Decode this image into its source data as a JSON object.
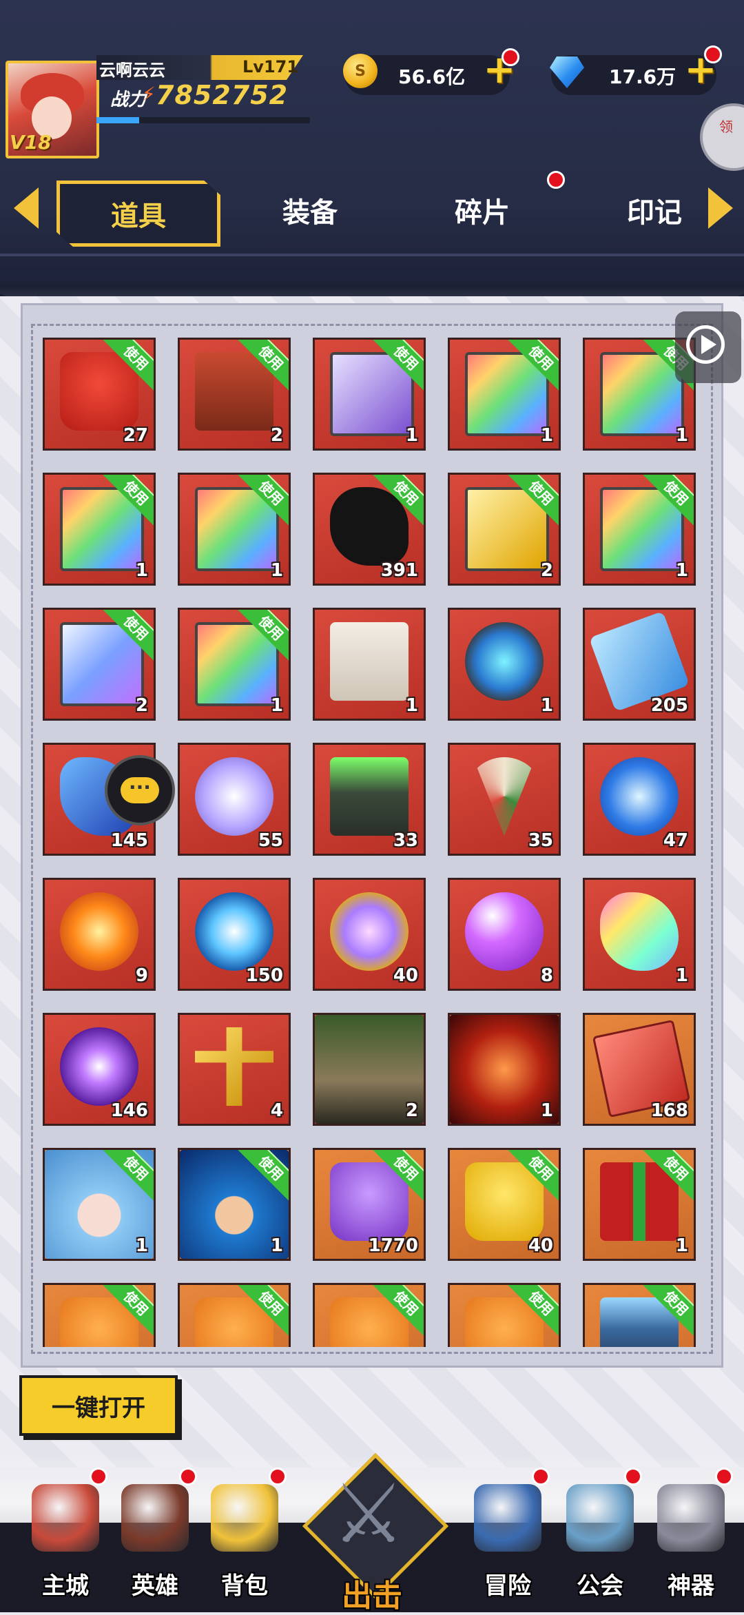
{
  "player": {
    "name": "云啊云云",
    "level": "Lv171",
    "vip": "V18",
    "power_label": "战力",
    "power": "7852752",
    "exp_fraction": 0.2
  },
  "currency": {
    "gold": "56.6亿",
    "gems": "17.6万"
  },
  "side_button_text": "领",
  "tabs": [
    {
      "label": "道具",
      "active": true
    },
    {
      "label": "装备",
      "active": false
    },
    {
      "label": "碎片",
      "active": false,
      "badge": true
    },
    {
      "label": "印记",
      "active": false
    }
  ],
  "use_tag": "使用",
  "items": [
    {
      "icon": "red-bag-icon",
      "count": "27",
      "use": true,
      "bg": "red"
    },
    {
      "icon": "treasure-chest-icon",
      "count": "2",
      "use": true,
      "bg": "red"
    },
    {
      "icon": "purple-card-pack-icon",
      "count": "1",
      "use": true,
      "bg": "red"
    },
    {
      "icon": "rainbow-card-pack-icon",
      "count": "1",
      "use": true,
      "bg": "red"
    },
    {
      "icon": "rainbow-card-pack-icon",
      "count": "1",
      "use": true,
      "bg": "red"
    },
    {
      "icon": "rainbow-card-pack-icon",
      "count": "1",
      "use": true,
      "bg": "red"
    },
    {
      "icon": "rainbow-card-pack-icon",
      "count": "1",
      "use": true,
      "bg": "red"
    },
    {
      "icon": "mystery-hero-icon",
      "count": "391",
      "use": true,
      "bg": "red"
    },
    {
      "icon": "gold-card-pack-icon",
      "count": "2",
      "use": true,
      "bg": "red"
    },
    {
      "icon": "rainbow-card-pack-icon",
      "count": "1",
      "use": true,
      "bg": "red"
    },
    {
      "icon": "glowing-card-pack-icon",
      "count": "2",
      "use": true,
      "bg": "red"
    },
    {
      "icon": "rainbow-card-pack-icon",
      "count": "1",
      "use": true,
      "bg": "red"
    },
    {
      "icon": "scroll-icon",
      "count": "1",
      "use": false,
      "bg": "red"
    },
    {
      "icon": "blue-rune-icon",
      "count": "1",
      "use": false,
      "bg": "red"
    },
    {
      "icon": "blue-ticket-icon",
      "count": "205",
      "use": false,
      "bg": "red"
    },
    {
      "icon": "blue-crystal-icon",
      "count": "145",
      "use": false,
      "bg": "red"
    },
    {
      "icon": "silver-coin-icon",
      "count": "55",
      "use": false,
      "bg": "red"
    },
    {
      "icon": "green-cauldron-icon",
      "count": "33",
      "use": false,
      "bg": "red"
    },
    {
      "icon": "ice-cream-icon",
      "count": "35",
      "use": false,
      "bg": "red"
    },
    {
      "icon": "blue-gem-icon",
      "count": "47",
      "use": false,
      "bg": "red"
    },
    {
      "icon": "fire-orb-icon",
      "count": "9",
      "use": false,
      "bg": "red"
    },
    {
      "icon": "water-orb-icon",
      "count": "150",
      "use": false,
      "bg": "red"
    },
    {
      "icon": "star-orb-icon",
      "count": "40",
      "use": false,
      "bg": "red"
    },
    {
      "icon": "purple-orb-icon",
      "count": "8",
      "use": false,
      "bg": "red"
    },
    {
      "icon": "rainbow-crystal-icon",
      "count": "1",
      "use": false,
      "bg": "red"
    },
    {
      "icon": "purple-vortex-icon",
      "count": "146",
      "use": false,
      "bg": "red"
    },
    {
      "icon": "golden-key-icon",
      "count": "4",
      "use": false,
      "bg": "red"
    },
    {
      "icon": "serpent-portrait-icon",
      "count": "2",
      "use": false,
      "bg": "red"
    },
    {
      "icon": "phoenix-portrait-icon",
      "count": "1",
      "use": false,
      "bg": "red"
    },
    {
      "icon": "red-card-icon",
      "count": "168",
      "use": false,
      "bg": "orange"
    },
    {
      "icon": "blue-hair-girl-skin-icon",
      "count": "1",
      "use": true,
      "bg": "orange"
    },
    {
      "icon": "warrior-skin-icon",
      "count": "1",
      "use": true,
      "bg": "orange"
    },
    {
      "icon": "purple-bag-icon",
      "count": "1770",
      "use": true,
      "bg": "orange"
    },
    {
      "icon": "yellow-bag-icon",
      "count": "40",
      "use": true,
      "bg": "orange"
    },
    {
      "icon": "gift-box-icon",
      "count": "1",
      "use": true,
      "bg": "orange"
    },
    {
      "icon": "orange-bag-icon",
      "count": "",
      "use": true,
      "bg": "orange"
    },
    {
      "icon": "orange-bag-icon",
      "count": "",
      "use": true,
      "bg": "orange"
    },
    {
      "icon": "orange-bag-icon",
      "count": "",
      "use": true,
      "bg": "orange"
    },
    {
      "icon": "orange-bag-icon",
      "count": "",
      "use": true,
      "bg": "orange"
    },
    {
      "icon": "tech-chest-icon",
      "count": "",
      "use": true,
      "bg": "orange"
    }
  ],
  "open_all_button": "一键打开",
  "nav": [
    {
      "label": "主城",
      "icon": "castle-icon",
      "dot": true
    },
    {
      "label": "英雄",
      "icon": "hero-icon",
      "dot": true
    },
    {
      "label": "背包",
      "icon": "backpack-icon",
      "dot": true
    },
    {
      "label": "出击",
      "icon": "crossed-swords-icon",
      "dot": false
    },
    {
      "label": "冒险",
      "icon": "compass-icon",
      "dot": true
    },
    {
      "label": "公会",
      "icon": "guild-banner-icon",
      "dot": true
    },
    {
      "label": "神器",
      "icon": "artifact-anvil-icon",
      "dot": true
    }
  ],
  "colors": {
    "accent_gold": "#f2c23b",
    "header_bg": "#262c45",
    "cell_red": "#c9382c",
    "cell_orange": "#d97a33",
    "use_green": "#3bbf3b",
    "badge_red": "#e3111e"
  }
}
